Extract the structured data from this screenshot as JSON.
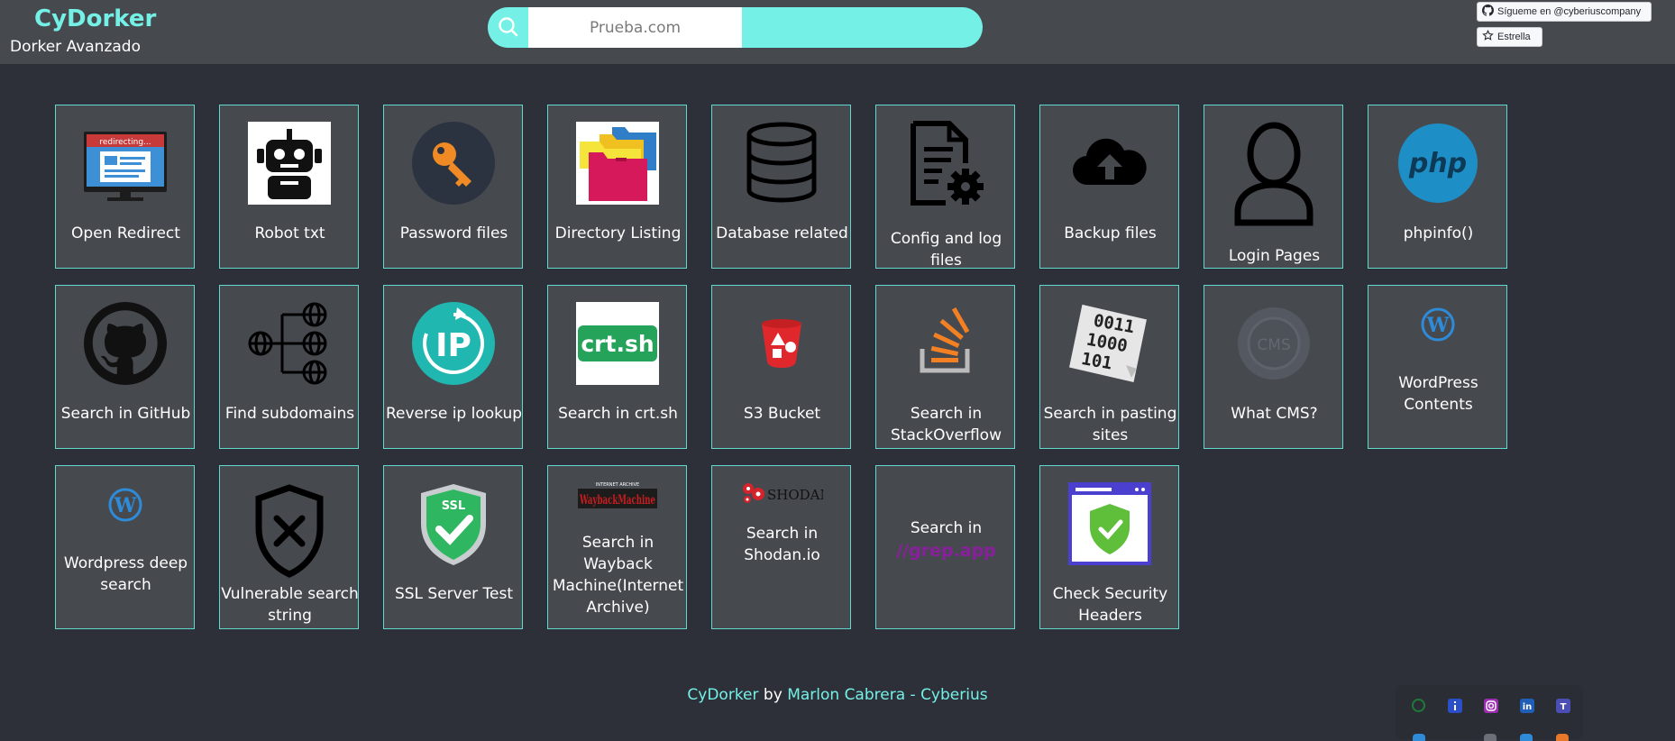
{
  "header": {
    "brand": "CyDorker",
    "subtitle": "Dorker Avanzado",
    "search": {
      "value": "Prueba.com",
      "placeholder": "Prueba.com"
    },
    "github_follow": "Sígueme en @cyberiuscompany",
    "github_star": "Estrella"
  },
  "cards": [
    {
      "label": "Open Redirect",
      "icon": "redirect-monitor-icon"
    },
    {
      "label": "Robot txt",
      "icon": "robot-icon"
    },
    {
      "label": "Password files",
      "icon": "key-icon"
    },
    {
      "label": "Directory Listing",
      "icon": "folders-icon"
    },
    {
      "label": "Database related",
      "icon": "database-icon"
    },
    {
      "label": "Config and log files",
      "icon": "config-file-gear-icon"
    },
    {
      "label": "Backup files",
      "icon": "cloud-upload-icon"
    },
    {
      "label": "Login Pages",
      "icon": "user-icon"
    },
    {
      "label": "phpinfo()",
      "icon": "php-icon",
      "icon_text": "php"
    },
    {
      "label": "Search in GitHub",
      "icon": "github-icon"
    },
    {
      "label": "Find subdomains",
      "icon": "subdomains-network-icon"
    },
    {
      "label": "Reverse ip lookup",
      "icon": "reverse-ip-icon",
      "icon_text": "IP"
    },
    {
      "label": "Search in crt.sh",
      "icon": "crtsh-icon",
      "icon_text": "crt.sh"
    },
    {
      "label": "S3 Bucket",
      "icon": "s3-bucket-icon"
    },
    {
      "label": "Search in StackOverflow",
      "icon": "stackoverflow-icon"
    },
    {
      "label": "Search in pasting sites",
      "icon": "binary-paper-icon",
      "icon_text": "0011 1000 101"
    },
    {
      "label": "What CMS?",
      "icon": "cms-icon",
      "icon_text": "CMS"
    },
    {
      "label": "WordPress Contents",
      "icon": "wordpress-icon"
    },
    {
      "label": "Wordpress deep search",
      "icon": "wordpress-icon"
    },
    {
      "label": "Vulnerable search string",
      "icon": "shield-x-icon"
    },
    {
      "label": "SSL Server Test",
      "icon": "ssl-shield-icon",
      "icon_text": "SSL"
    },
    {
      "label": "Search in Wayback Machine(Internet Archive)",
      "icon": "wayback-machine-icon",
      "icon_text": "INTERNET ARCHIVE",
      "icon_text2": "WaybackMachine"
    },
    {
      "label": "Search in Shodan.io",
      "icon": "shodan-icon",
      "icon_text": "SHODAN"
    },
    {
      "label": "Search in",
      "icon": "grep-app-icon",
      "icon_text": "//grep.app"
    },
    {
      "label": "Check Security Headers",
      "icon": "security-headers-icon"
    }
  ],
  "footer": {
    "brand": "CyDorker",
    "by": " by ",
    "author": "Marlon Cabrera - Cyberius"
  },
  "social": [
    "whatsapp-icon",
    "info-icon",
    "instagram-icon",
    "linkedin-icon",
    "teams-icon"
  ],
  "colors": {
    "accent": "#74f0e6",
    "background": "#2d3038",
    "header": "#464a4f",
    "card": "#464a4f",
    "card_border": "#5fd8d0"
  }
}
